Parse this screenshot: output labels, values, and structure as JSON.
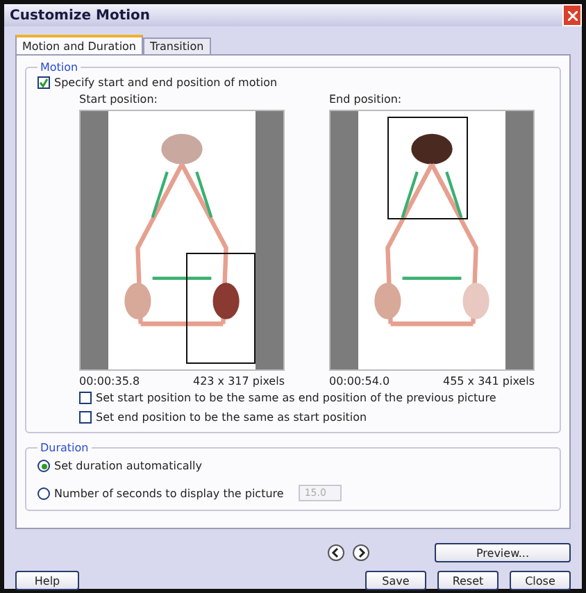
{
  "window": {
    "title": "Customize Motion"
  },
  "tabs": [
    {
      "label": "Motion and Duration",
      "selected": true
    },
    {
      "label": "Transition",
      "selected": false
    }
  ],
  "motion": {
    "label": "Motion",
    "specify": {
      "label": "Specify start and end position of motion",
      "checked": true
    },
    "previews": [
      {
        "kind": "start",
        "label": "Start position:",
        "time": "00:00:35.8",
        "size": "423 x 317 pixels"
      },
      {
        "kind": "end",
        "label": "End position:",
        "time": "00:00:54.0",
        "size": "455 x 341 pixels"
      }
    ],
    "options": [
      {
        "label": "Set start position to be the same as end position of the previous picture",
        "checked": false
      },
      {
        "label": "Set end position to be the same as start position",
        "checked": false
      }
    ]
  },
  "duration": {
    "label": "Duration",
    "radios": [
      {
        "label": "Set duration automatically",
        "selected": true
      },
      {
        "label": "Number of seconds to display the picture",
        "selected": false,
        "value": "15.0"
      }
    ]
  },
  "preview_button": "Preview...",
  "buttons": [
    {
      "label": "Help",
      "kind": "left"
    },
    {
      "label": "Save",
      "kind": "right"
    },
    {
      "label": "Reset",
      "kind": "right"
    },
    {
      "label": "Close",
      "kind": "right"
    }
  ]
}
